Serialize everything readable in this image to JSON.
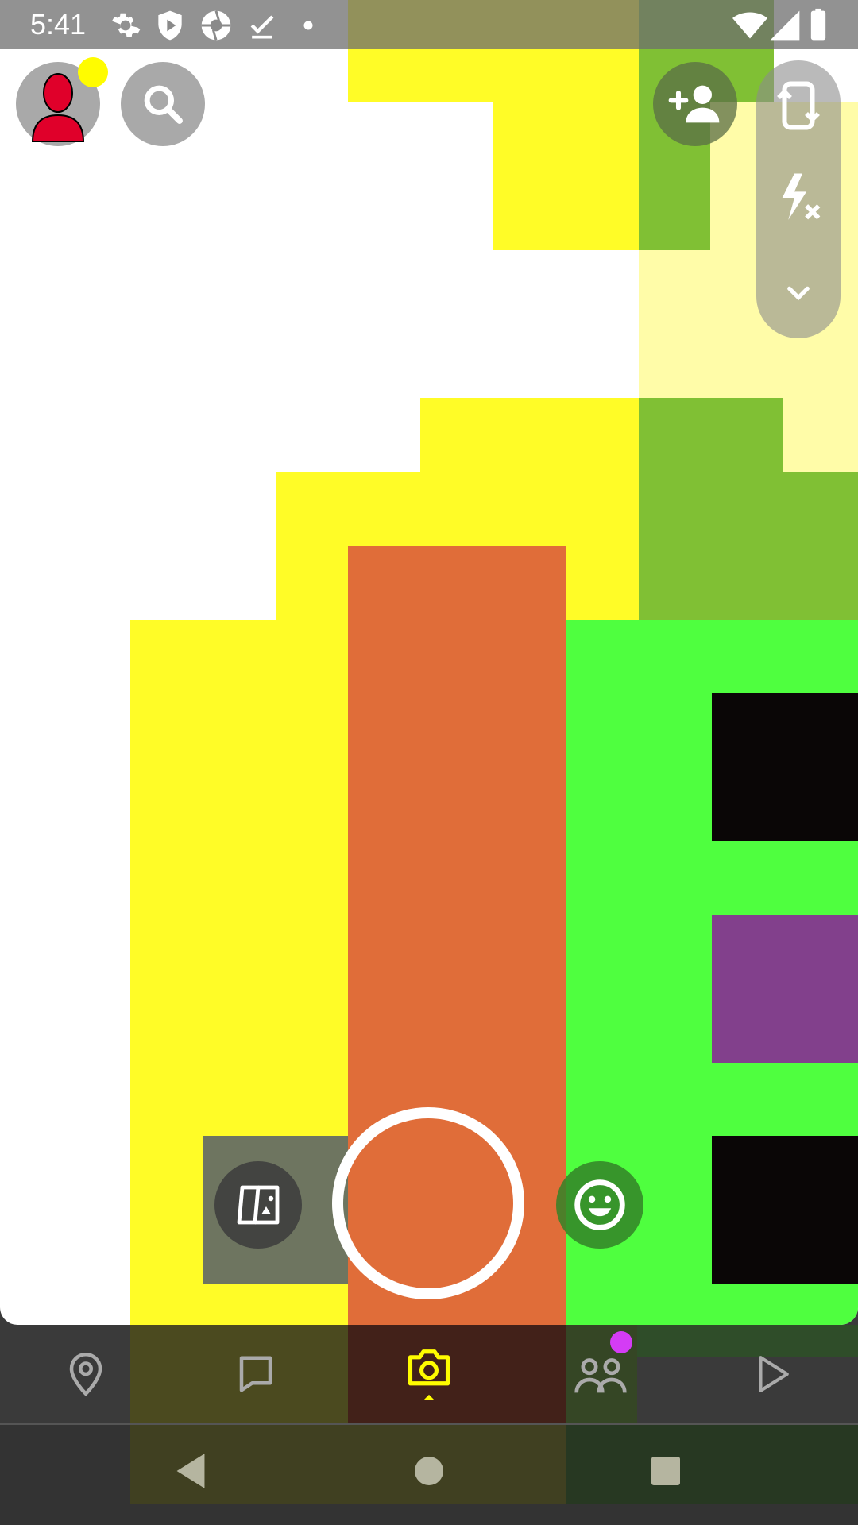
{
  "status_bar": {
    "time": "5:41",
    "left_icons": [
      "gear-icon",
      "shield-play-icon",
      "aperture-icon",
      "download-done-icon",
      "dot-icon"
    ],
    "right_icons": [
      "wifi-icon",
      "cell-signal-icon",
      "battery-icon"
    ]
  },
  "header": {
    "profile_icon": "bitmoji-avatar-icon",
    "search_icon": "search-icon",
    "add_friend_icon": "add-friend-icon"
  },
  "camera_tools": {
    "items": [
      "flip-camera-icon",
      "flash-off-icon",
      "chevron-down-icon"
    ]
  },
  "capture": {
    "memories_icon": "memories-cards-icon",
    "shutter": "shutter-button",
    "lens_icon": "smiley-lens-icon"
  },
  "tab_bar": {
    "tabs": [
      {
        "name": "map",
        "icon": "map-pin-icon"
      },
      {
        "name": "chat",
        "icon": "chat-bubble-icon"
      },
      {
        "name": "camera",
        "icon": "camera-icon",
        "active": true
      },
      {
        "name": "stories",
        "icon": "friends-icon",
        "badge": true
      },
      {
        "name": "spotlight",
        "icon": "play-icon"
      }
    ],
    "active_color": "#FFFC00",
    "badge_color": "#D43CF5"
  },
  "system_nav": {
    "buttons": [
      "back-icon",
      "home-icon",
      "recents-icon"
    ]
  },
  "colors": {
    "yellow": "#FFFC27",
    "orange": "#E06D39",
    "green": "#4FFF3F",
    "olive_green": "#80C034",
    "pale_yellow": "#FFFCA8",
    "black": "#0A0606",
    "purple": "#82408C",
    "grey_block": "#6E7560"
  }
}
